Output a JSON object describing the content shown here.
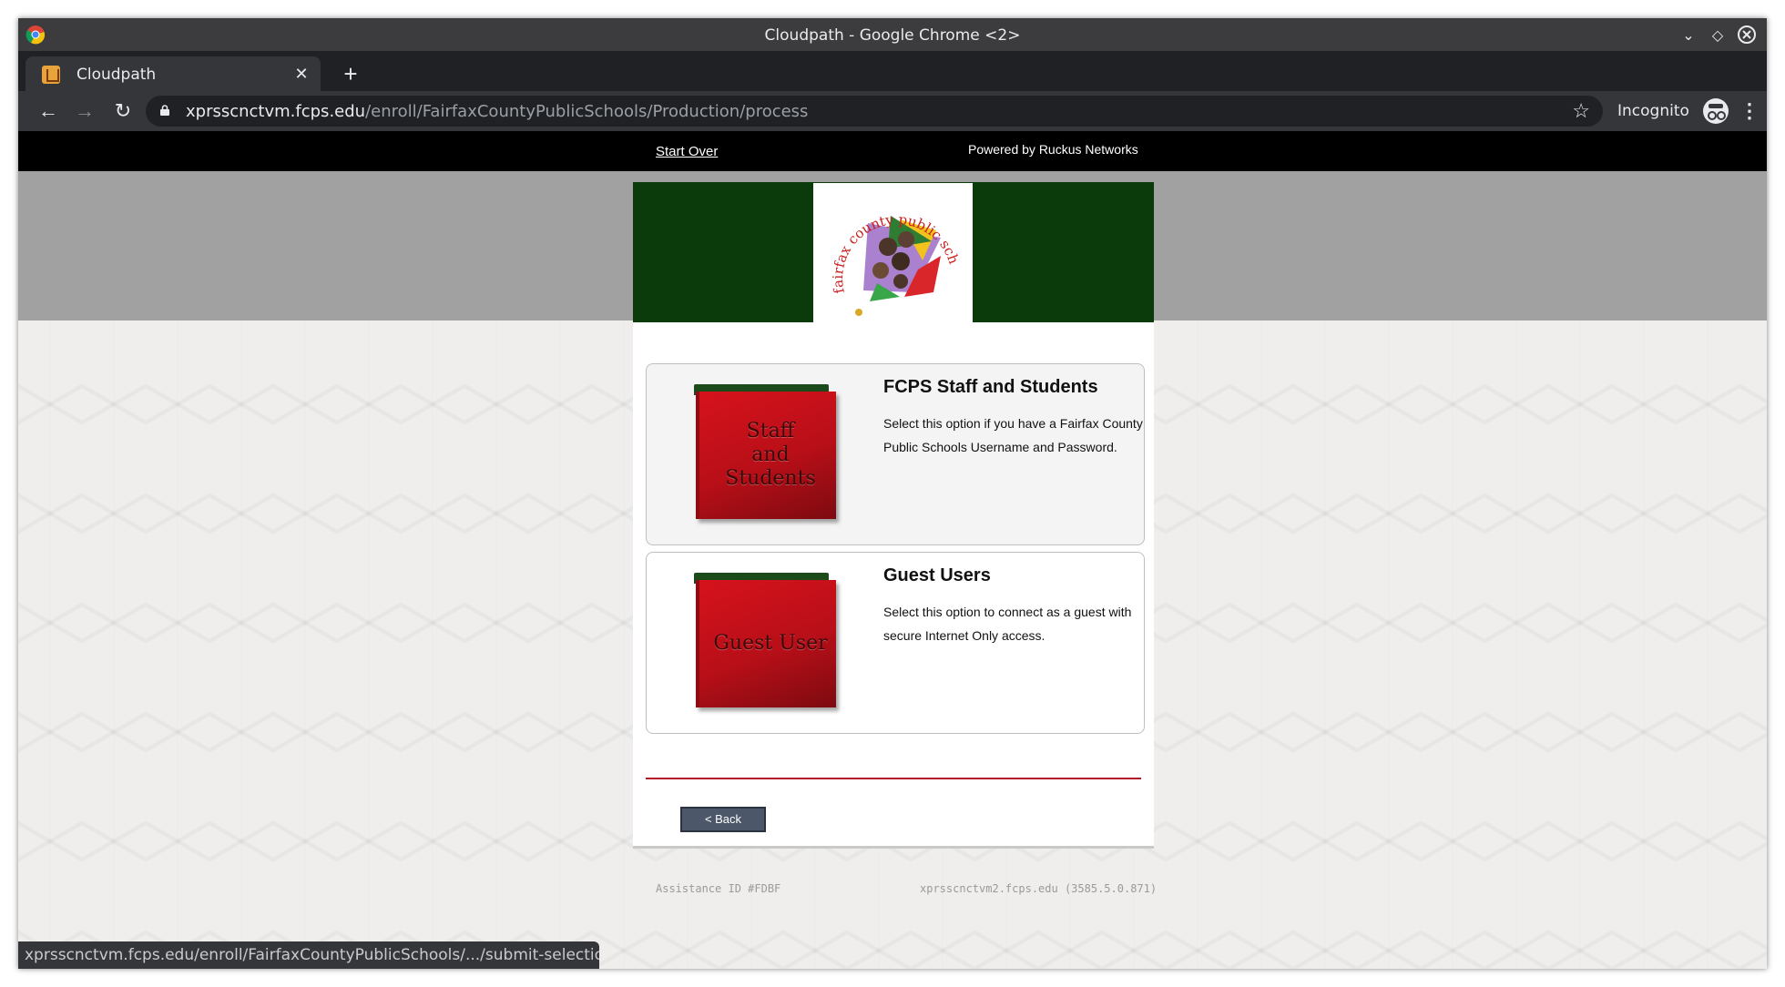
{
  "window": {
    "title": "Cloudpath - Google Chrome <2>"
  },
  "tab": {
    "title": "Cloudpath"
  },
  "address_bar": {
    "host": "xprsscnctvm.fcps.edu",
    "path": "/enroll/FairfaxCountyPublicSchools/Production/process"
  },
  "profile": {
    "label": "Incognito"
  },
  "topbar": {
    "start_over": "Start Over",
    "powered_by": "Powered by Ruckus Networks"
  },
  "logo": {
    "ring_text": "fairfax county public schools"
  },
  "options": [
    {
      "image_label_lines": [
        "Staff",
        "and",
        "Students"
      ],
      "title": "FCPS Staff and Students",
      "description": "Select this option if you have a Fairfax County Public Schools Username and Password."
    },
    {
      "image_label_lines": [
        "Guest User"
      ],
      "title": "Guest Users",
      "description": "Select this option to connect as a guest with secure Internet Only access."
    }
  ],
  "back_button": "< Back",
  "footer": {
    "assistance_id": "Assistance ID #FDBF",
    "server": "xprsscnctvm2.fcps.edu (3585.5.0.871)"
  },
  "status_bar": "xprsscnctvm.fcps.edu/enroll/FairfaxCountyPublicSchools/.../submit-selection...",
  "colors": {
    "header_green": "#0b3a0b",
    "binder_red": "#c8101a",
    "divider_red": "#b5132a",
    "back_button": "#4c586a"
  }
}
